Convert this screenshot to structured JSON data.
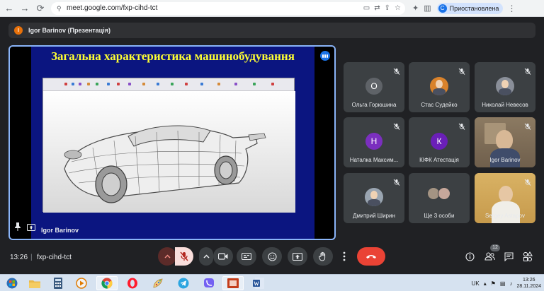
{
  "browser": {
    "url": "meet.google.com/fxp-cihd-tct",
    "profile_label": "Приостановлена",
    "profile_initial": "C"
  },
  "presenter_bar": {
    "initial": "I",
    "label": "Igor Barinov (Презентація)"
  },
  "presentation": {
    "slide_title": "Загальна характеристика машинобудування",
    "presenter_name": "Igor Barinov"
  },
  "participants": [
    {
      "name": "Ольга Горюшина",
      "initial": "О",
      "avatar_color": "#5f6368",
      "muted": true
    },
    {
      "name": "Стас Судейко",
      "initial": "",
      "avatar_color": "#d9822b",
      "muted": true
    },
    {
      "name": "Николай Невесов",
      "initial": "",
      "avatar_color": "#8a8f99",
      "muted": true
    },
    {
      "name": "Наталка Максим...",
      "initial": "Н",
      "avatar_color": "#7b2fbf",
      "muted": true
    },
    {
      "name": "КІФК Атестація",
      "initial": "К",
      "avatar_color": "#6a1fb8",
      "muted": true
    },
    {
      "name": "Igor Barinov",
      "initial": "",
      "avatar_color": "#9c7d62",
      "muted": true
    },
    {
      "name": "Дмитрий Ширин",
      "initial": "",
      "avatar_color": "#9aa5b1",
      "muted": true
    },
    {
      "name": "Ще 3 особи",
      "initial": "",
      "avatar_color": "#5f6368",
      "muted": false
    },
    {
      "name": "Sergey Astapov",
      "initial": "",
      "avatar_color": "#c9a35a",
      "muted": true
    }
  ],
  "bottom_bar": {
    "time": "13:26",
    "separator": "|",
    "meeting_code": "fxp-cihd-tct",
    "people_count": "12"
  },
  "taskbar": {
    "language": "UK",
    "time": "13:26",
    "date": "28.11.2024"
  },
  "colors": {
    "background": "#202124",
    "tile": "#3c4043",
    "accent_blue": "#8ab4f8",
    "mic_muted_red": "#f28b82",
    "end_call_red": "#ea4335",
    "slide_blue": "#0b1580",
    "slide_title_yellow": "#ffff33"
  }
}
